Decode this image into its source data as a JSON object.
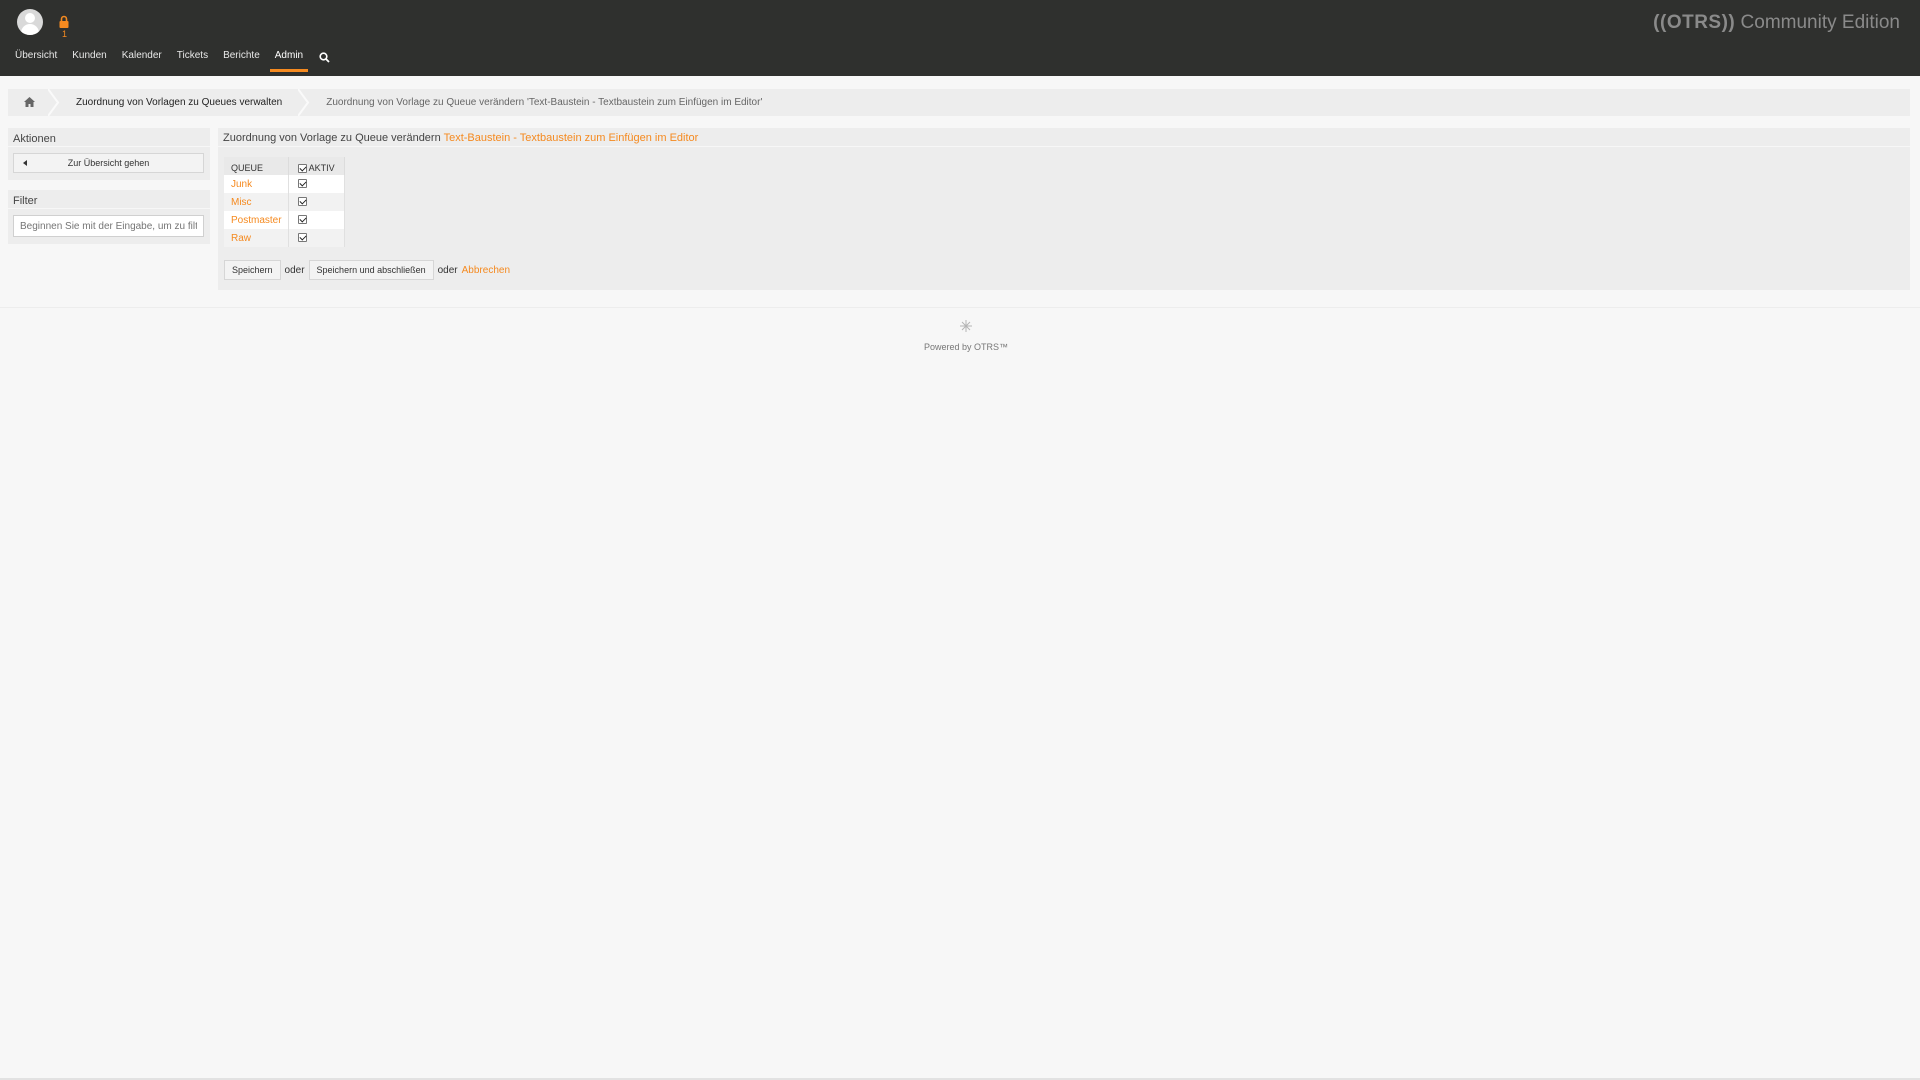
{
  "header": {
    "logo_brand": "((OTRS))",
    "logo_edition": "Community Edition",
    "lock_count": "1"
  },
  "nav": {
    "items": [
      {
        "label": "Übersicht"
      },
      {
        "label": "Kunden"
      },
      {
        "label": "Kalender"
      },
      {
        "label": "Tickets"
      },
      {
        "label": "Berichte"
      },
      {
        "label": "Admin"
      }
    ],
    "active": "Admin"
  },
  "breadcrumb": {
    "items": [
      {
        "label": "Zuordnung von Vorlagen zu Queues verwalten"
      },
      {
        "label": "Zuordnung von Vorlage zu Queue verändern 'Text-Baustein - Textbaustein zum Einfügen im Editor'"
      }
    ]
  },
  "sidebar": {
    "actions": {
      "title": "Aktionen",
      "back_button": "Zur Übersicht gehen"
    },
    "filter": {
      "title": "Filter",
      "placeholder": "Beginnen Sie mit der Eingabe, um zu filtern..."
    }
  },
  "main": {
    "title_prefix": "Zuordnung von Vorlage zu Queue verändern",
    "title_link": "Text-Baustein - Textbaustein zum Einfügen im Editor",
    "table": {
      "col_queue": "QUEUE",
      "col_active": "AKTIV",
      "rows": [
        {
          "name": "Junk",
          "active": true
        },
        {
          "name": "Misc",
          "active": true
        },
        {
          "name": "Postmaster",
          "active": true
        },
        {
          "name": "Raw",
          "active": true
        }
      ]
    },
    "buttons": {
      "save": "Speichern",
      "or1": "oder",
      "save_close": "Speichern und abschließen",
      "or2": "oder",
      "cancel": "Abbrechen"
    }
  },
  "footer": {
    "powered": "Powered by OTRS™"
  },
  "colors": {
    "accent": "#f58a20",
    "topbar": "#2f302e",
    "background": "#f7f7f7"
  }
}
